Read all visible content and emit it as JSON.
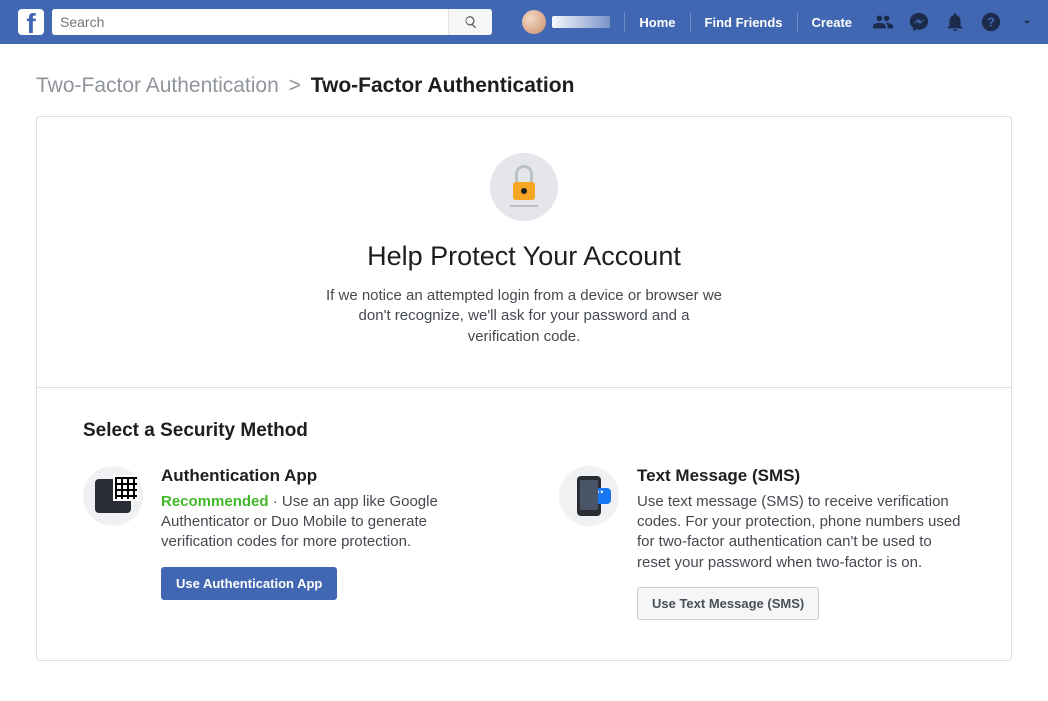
{
  "header": {
    "search_placeholder": "Search",
    "nav": {
      "home": "Home",
      "find_friends": "Find Friends",
      "create": "Create"
    }
  },
  "breadcrumb": {
    "parent": "Two-Factor Authentication",
    "separator": ">",
    "current": "Two-Factor Authentication"
  },
  "hero": {
    "title": "Help Protect Your Account",
    "body": "If we notice an attempted login from a device or browser we don't recognize, we'll ask for your password and a verification code."
  },
  "methods": {
    "title": "Select a Security Method",
    "app": {
      "title": "Authentication App",
      "recommended": "Recommended",
      "separator": " · ",
      "desc": "Use an app like Google Authenticator or Duo Mobile to generate verification codes for more protection.",
      "button": "Use Authentication App"
    },
    "sms": {
      "title": "Text Message (SMS)",
      "desc": "Use text message (SMS) to receive verification codes. For your protection, phone numbers used for two-factor authentication can't be used to reset your password when two-factor is on.",
      "button": "Use Text Message (SMS)"
    }
  }
}
